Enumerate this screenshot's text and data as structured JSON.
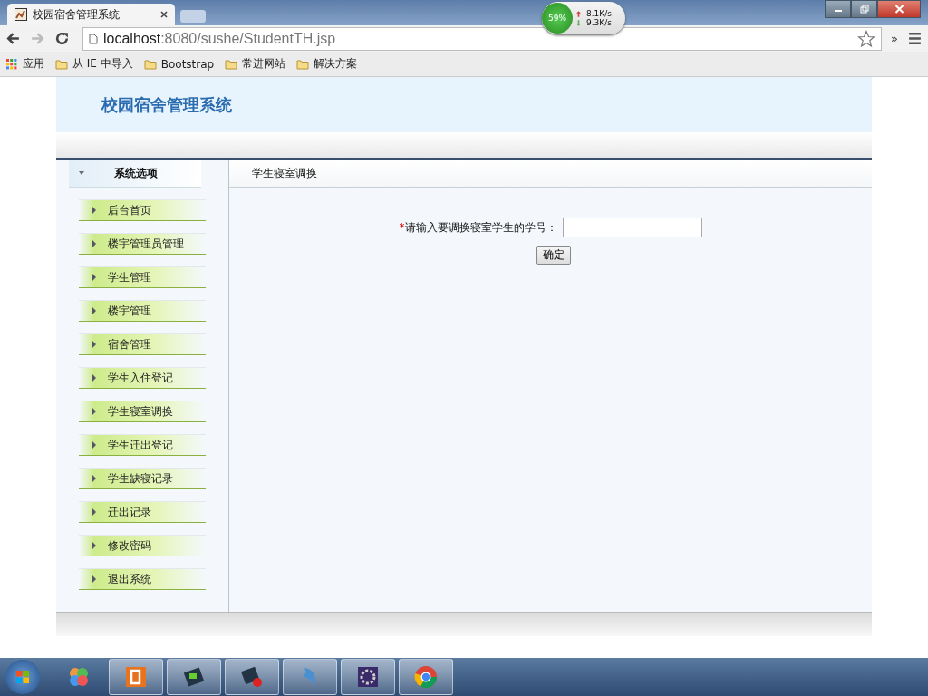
{
  "browser": {
    "tab_title": "校园宿舍管理系统",
    "url_host": "localhost",
    "url_rest": ":8080/sushe/StudentTH.jsp",
    "more": "»",
    "monitor": {
      "cpu": "59%",
      "up": "8.1K/s",
      "down": "9.3K/s"
    },
    "bookmarks": [
      {
        "kind": "apps",
        "label": "应用"
      },
      {
        "kind": "folder",
        "label": "从 IE 中导入"
      },
      {
        "kind": "folder",
        "label": "Bootstrap"
      },
      {
        "kind": "folder",
        "label": "常进网站"
      },
      {
        "kind": "folder",
        "label": "解决方案"
      }
    ]
  },
  "page": {
    "title": "校园宿舍管理系统",
    "sidebar": {
      "header": "系统选项",
      "expanded": true,
      "items": [
        "后台首页",
        "楼宇管理员管理",
        "学生管理",
        "楼宇管理",
        "宿舍管理",
        "学生入住登记",
        "学生寝室调换",
        "学生迁出登记",
        "学生缺寝记录",
        "迁出记录",
        "修改密码",
        "退出系统"
      ]
    },
    "content": {
      "title": "学生寝室调换",
      "required_mark": "*",
      "label": "请输入要调换寝室学生的学号：",
      "button": "确定"
    }
  },
  "taskbar": {
    "apps": [
      {
        "kind": "palette",
        "active": false
      },
      {
        "kind": "slides",
        "active": true
      },
      {
        "kind": "terminal",
        "active": true
      },
      {
        "kind": "recorder",
        "active": true
      },
      {
        "kind": "dolphin",
        "active": true
      },
      {
        "kind": "ide",
        "active": true
      },
      {
        "kind": "browser",
        "active": true
      }
    ]
  }
}
